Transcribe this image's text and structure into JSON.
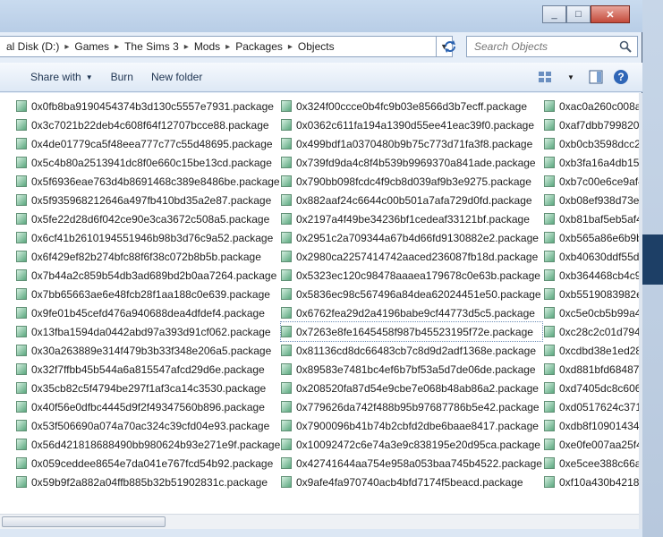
{
  "window": {
    "minimize_label": "_",
    "maximize_label": "□",
    "close_label": "✕"
  },
  "breadcrumb": {
    "items": [
      "al Disk (D:)",
      "Games",
      "The Sims 3",
      "Mods",
      "Packages",
      "Objects"
    ]
  },
  "search": {
    "placeholder": "Search Objects"
  },
  "toolbar": {
    "share_label": "Share with",
    "burn_label": "Burn",
    "new_folder_label": "New folder"
  },
  "icons": {
    "file": "package-file-icon",
    "refresh": "refresh-icon",
    "search": "search-icon",
    "views": "views-icon",
    "preview": "preview-pane-icon",
    "help": "help-icon"
  },
  "focused_file": "0x7263e8fe1645458f987b45523195f72e.package",
  "files": {
    "column1": [
      "0x0fb8ba9190454374b3d130c5557e7931.package",
      "0x3c7021b22deb4c608f64f12707bcce88.package",
      "0x4de01779ca5f48eea777c77c55d48695.package",
      "0x5c4b80a2513941dc8f0e660c15be13cd.package",
      "0x5f6936eae763d4b8691468c389e8486be.package",
      "0x5f935968212646a497fb410bd35a2e87.package",
      "0x5fe22d28d6f042ce90e3ca3672c508a5.package",
      "0x6cf41b2610194551946b98b3d76c9a52.package",
      "0x6f429ef82b274bfc88f6f38c072b8b5b.package",
      "0x7b44a2c859b54db3ad689bd2b0aa7264.package",
      "0x7bb65663ae6e48fcb28f1aa188c0e639.package",
      "0x9fe01b45cefd476a940688dea4dfdef4.package",
      "0x13fba1594da0442abd97a393d91cf062.package",
      "0x30a263889e314f479b3b33f348e206a5.package",
      "0x32f7ffbb45b544a6a815547afcd29d6e.package",
      "0x35cb82c5f4794be297f1af3ca14c3530.package",
      "0x40f56e0dfbc4445d9f2f49347560b896.package",
      "0x53f506690a074a70ac324c39cfd04e93.package",
      "0x56d421818688490bb980624b93e271e9f.package",
      "0x059ceddee8654e7da041e767fcd54b92.package",
      "0x59b9f2a882a04ffb885b32b51902831c.package"
    ],
    "column2": [
      "0x324f00ccce0b4fc9b03e8566d3b7ecff.package",
      "0x0362c611fa194a1390d55ee41eac39f0.package",
      "0x499bdf1a0370480b9b75c773d71fa3f8.package",
      "0x739fd9da4c8f4b539b9969370a841ade.package",
      "0x790bb098fcdc4f9cb8d039af9b3e9275.package",
      "0x882aaf24c6644c00b501a7afa729d0fd.package",
      "0x2197a4f49be34236bf1cedeaf33121bf.package",
      "0x2951c2a709344a67b4d66fd9130882e2.package",
      "0x2980ca2257414742aaced236087fb18d.package",
      "0x5323ec120c98478aaaea179678c0e63b.package",
      "0x5836ec98c567496a84dea62024451e50.package",
      "0x6762fea29d2a4196babe9cf44773d5c5.package",
      "0x7263e8fe1645458f987b45523195f72e.package",
      "0x81136cd8dc66483cb7c8d9d2adf1368e.package",
      "0x89583e7481bc4ef6b7bf53a5d7de06de.package",
      "0x208520fa87d54e9cbe7e068b48ab86a2.package",
      "0x779626da742f488b95b97687786b5e42.package",
      "0x7900096b41b74b2cbfd2dbe6baae8417.package",
      "0x10092472c6e74a3e9c838195e20d95ca.package",
      "0x42741644aa754e958a053baa745b4522.package",
      "0x9afe4fa970740acb4bfd7174f5beacd.package"
    ],
    "column3": [
      "0xac0a260c008a4",
      "0xaf7dbb7998204",
      "0xb0cb3598dcc24",
      "0xb3fa16a4db154",
      "0xb7c00e6ce9af4",
      "0xb08ef938d73e4",
      "0xb81baf5eb5af4",
      "0xb565a86e6b9b4",
      "0xb40630ddf55d4",
      "0xb364468cb4c94",
      "0xb5519083982e4",
      "0xc5e0cb5b99a44",
      "0xc28c2c01d7944",
      "0xcdbd38e1ed284",
      "0xd881bfd684874",
      "0xd7405dc8c6064",
      "0xd0517624c3714",
      "0xdb8f109014344",
      "0xe0fe007aa25f48",
      "0xe5cee388c66a4",
      "0xf10a430b42184"
    ]
  }
}
